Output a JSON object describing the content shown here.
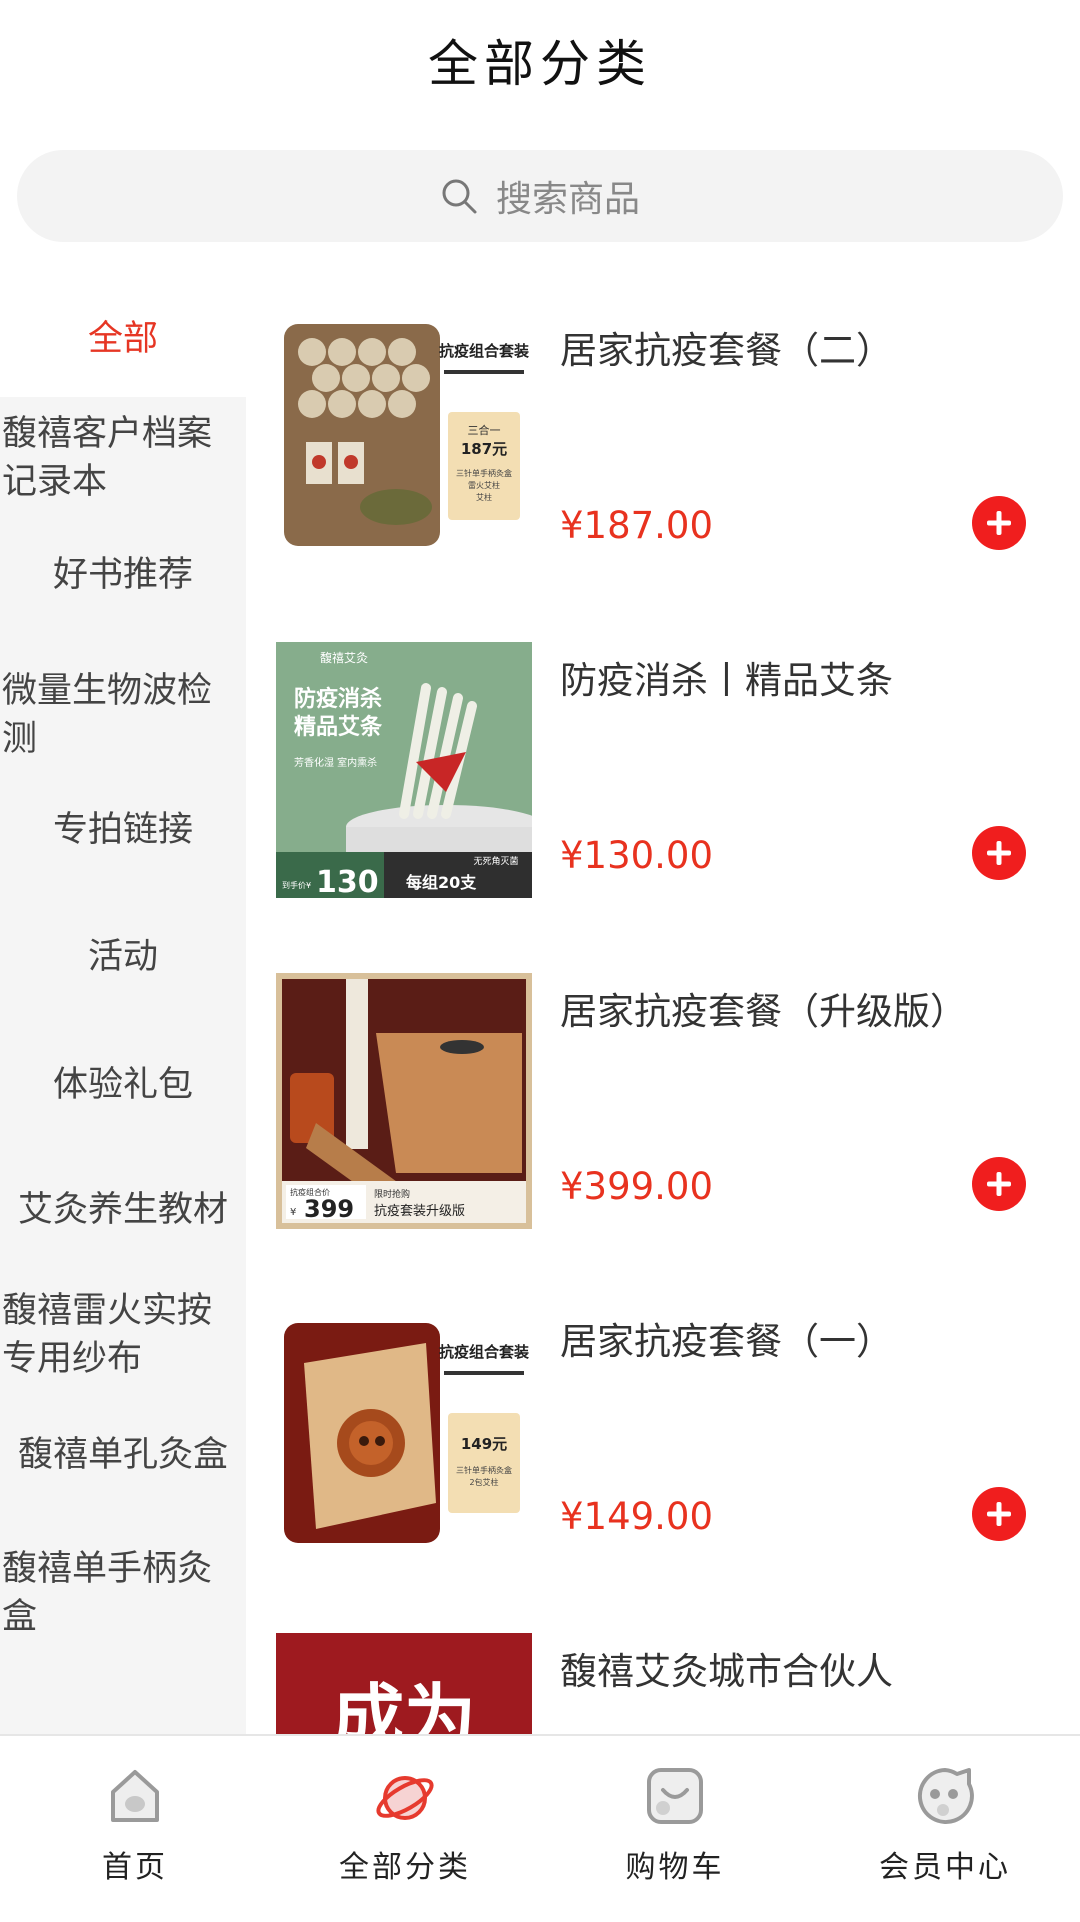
{
  "header": {
    "title": "全部分类"
  },
  "search": {
    "placeholder": "搜索商品"
  },
  "sidebar": {
    "items": [
      {
        "label": "全部"
      },
      {
        "label": "馥禧客户档案记录本"
      },
      {
        "label": "好书推荐"
      },
      {
        "label": "微量生物波检测"
      },
      {
        "label": "专拍链接"
      },
      {
        "label": "活动"
      },
      {
        "label": "体验礼包"
      },
      {
        "label": "艾灸养生教材"
      },
      {
        "label": "馥禧雷火实按专用纱布"
      },
      {
        "label": "馥禧单孔灸盒"
      },
      {
        "label": "馥禧单手柄灸盒"
      }
    ]
  },
  "products": [
    {
      "name": "居家抗疫套餐（二）",
      "price": "¥187.00",
      "img_tag": "抗疫组合套装",
      "img_box": "三合一",
      "img_price": "187元",
      "img_desc1": "三针单手柄灸盒",
      "img_desc2": "雷火艾柱",
      "img_desc3": "艾柱"
    },
    {
      "name": "防疫消杀丨精品艾条",
      "price": "¥130.00",
      "img_brand": "馥禧艾灸",
      "img_title1": "防疫消杀",
      "img_title2": "精品艾条",
      "img_sub": "芳香化湿  室内熏杀",
      "img_badge": "无死角灭菌",
      "img_handprice_label": "到手价¥",
      "img_handprice": "130",
      "img_group": "每组20支"
    },
    {
      "name": "居家抗疫套餐（升级版）",
      "price": "¥399.00",
      "img_tag": "抗疫组合价",
      "img_price": "399",
      "img_yen": "¥",
      "img_flash": "限时抢购",
      "img_upgrade": "抗疫套装升级版"
    },
    {
      "name": "居家抗疫套餐（一）",
      "price": "¥149.00",
      "img_tag": "抗疫组合套装",
      "img_price": "149元",
      "img_desc1": "三针单手柄灸盒",
      "img_desc2": "2包艾柱"
    },
    {
      "name": "馥禧艾灸城市合伙人",
      "price": "",
      "img_text": "成为"
    }
  ],
  "tabbar": {
    "items": [
      {
        "label": "首页"
      },
      {
        "label": "全部分类"
      },
      {
        "label": "购物车"
      },
      {
        "label": "会员中心"
      }
    ]
  },
  "colors": {
    "accent": "#e8321f",
    "add_button": "#f01e1e",
    "sidebar_bg": "#f5f5f5",
    "search_bg": "#f3f3f3"
  }
}
